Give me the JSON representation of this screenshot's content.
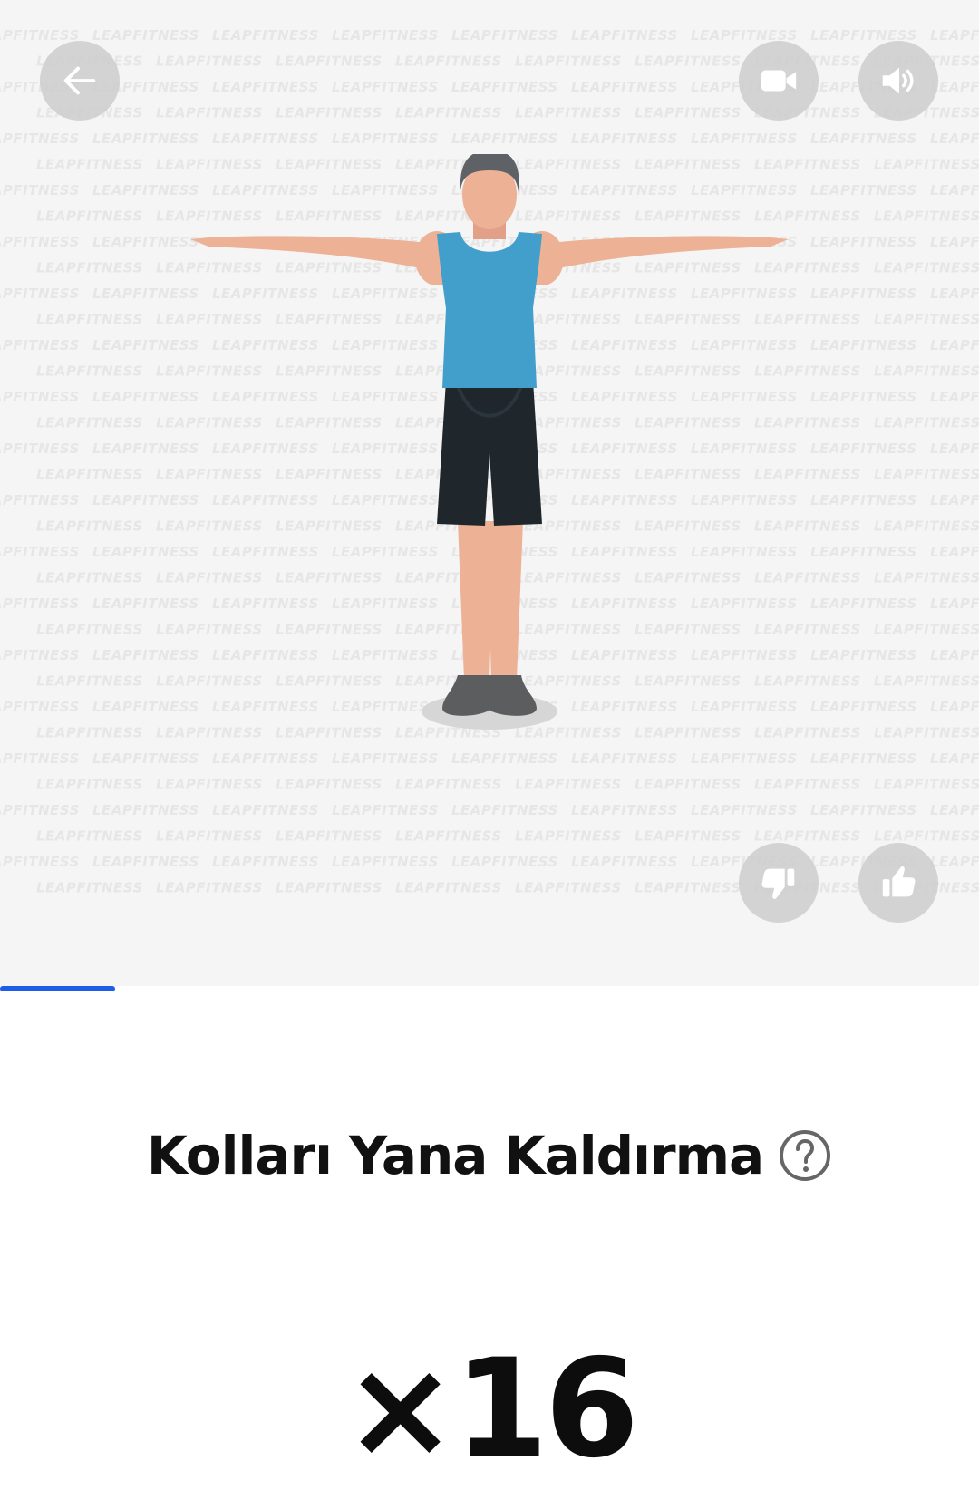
{
  "watermark": {
    "text": "LEAPFITNESS"
  },
  "toolbar": {
    "back_icon": "arrow-left-icon",
    "video_icon": "video-camera-icon",
    "sound_icon": "speaker-volume-icon"
  },
  "feedback": {
    "dislike_icon": "thumbs-down-icon",
    "like_icon": "thumbs-up-icon"
  },
  "progress": {
    "value": 0.118,
    "color": "#1e5de6"
  },
  "exercise": {
    "title": "Kolları Yana Kaldırma",
    "help_icon": "question-circle-icon",
    "reps": "×16"
  },
  "colors": {
    "media_bg": "#f5f5f5",
    "button_bg": "#cdcdcd",
    "tank_top": "#429fcb",
    "shorts": "#1f272c",
    "skin": "#edb196",
    "hair": "#5e6266",
    "shoes": "#5b5d5f"
  }
}
